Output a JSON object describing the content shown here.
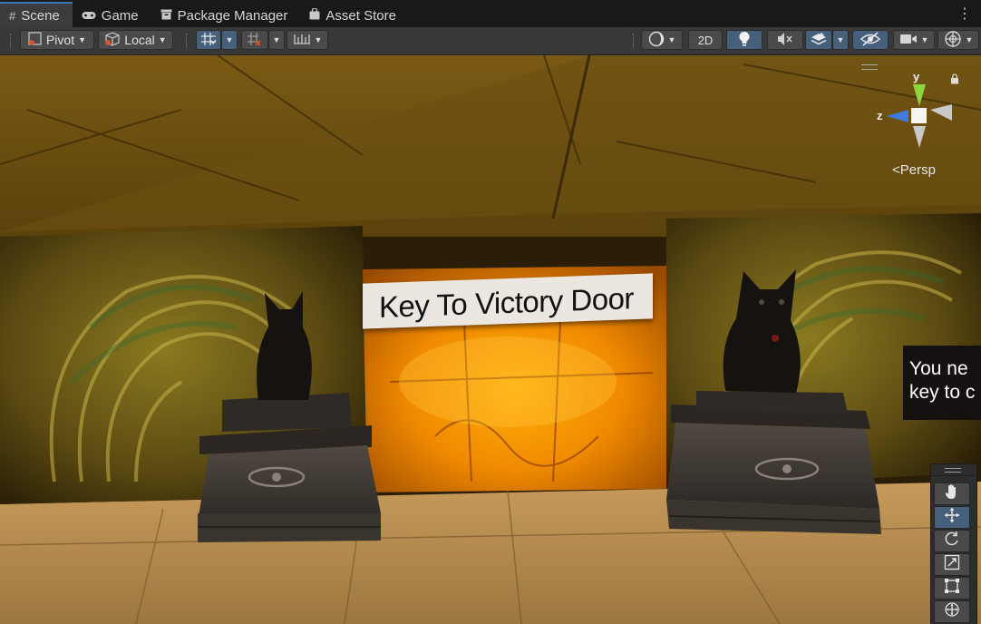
{
  "tabs": [
    {
      "label": "Scene",
      "icon": "grid-icon"
    },
    {
      "label": "Game",
      "icon": "gamepad-icon"
    },
    {
      "label": "Package Manager",
      "icon": "package-icon"
    },
    {
      "label": "Asset Store",
      "icon": "store-bag-icon"
    }
  ],
  "toolbar": {
    "pivot_label": "Pivot",
    "local_label": "Local",
    "mode_2d_label": "2D"
  },
  "scene": {
    "sign_main": "Key To Victory Door",
    "sign_side_line1": "You ne",
    "sign_side_line2": "key to c"
  },
  "gizmo": {
    "y_label": "y",
    "z_label": "z",
    "projection_label": "Persp"
  },
  "tools": [
    "hand-tool-icon",
    "move-tool-icon",
    "rotate-tool-icon",
    "scale-tool-icon",
    "rect-tool-icon",
    "transform-tool-icon"
  ],
  "colors": {
    "accent": "#3a79bb",
    "active_button": "#46607c",
    "gizmo_y": "#8ed63f",
    "gizmo_z": "#3f7ae0"
  }
}
